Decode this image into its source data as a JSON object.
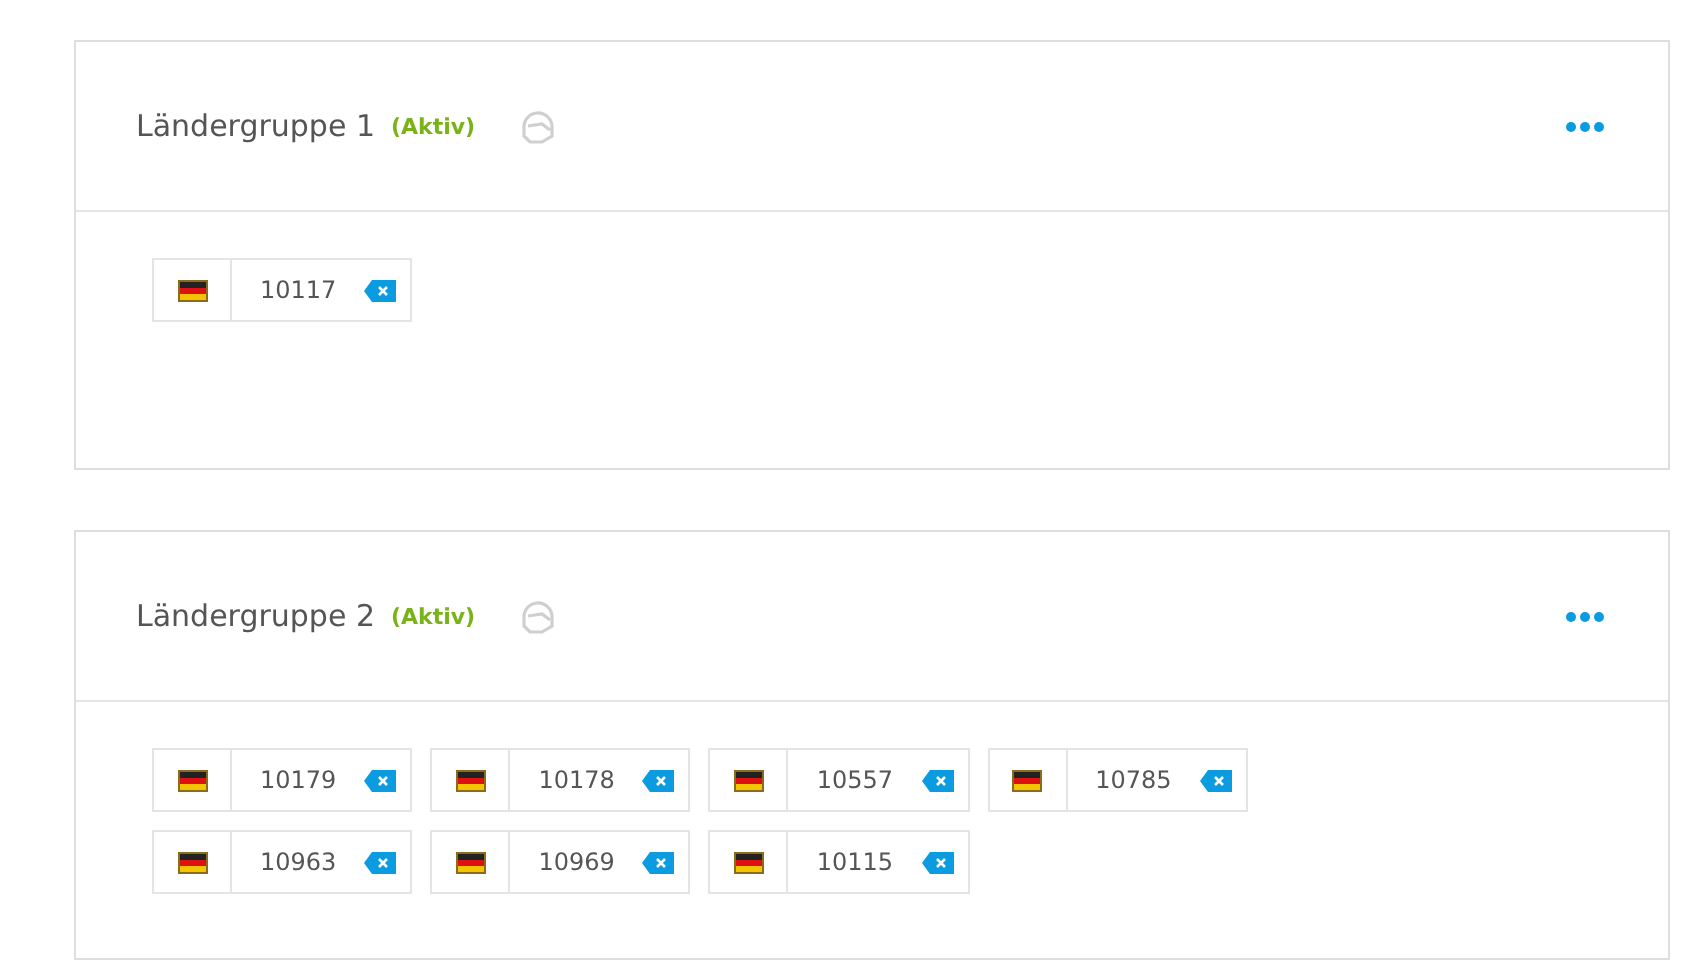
{
  "groups": [
    {
      "title": "Ländergruppe 1",
      "status": "(Aktiv)",
      "codes": [
        "10117"
      ]
    },
    {
      "title": "Ländergruppe 2",
      "status": "(Aktiv)",
      "codes": [
        "10179",
        "10178",
        "10557",
        "10785",
        "10963",
        "10969",
        "10115"
      ]
    }
  ]
}
